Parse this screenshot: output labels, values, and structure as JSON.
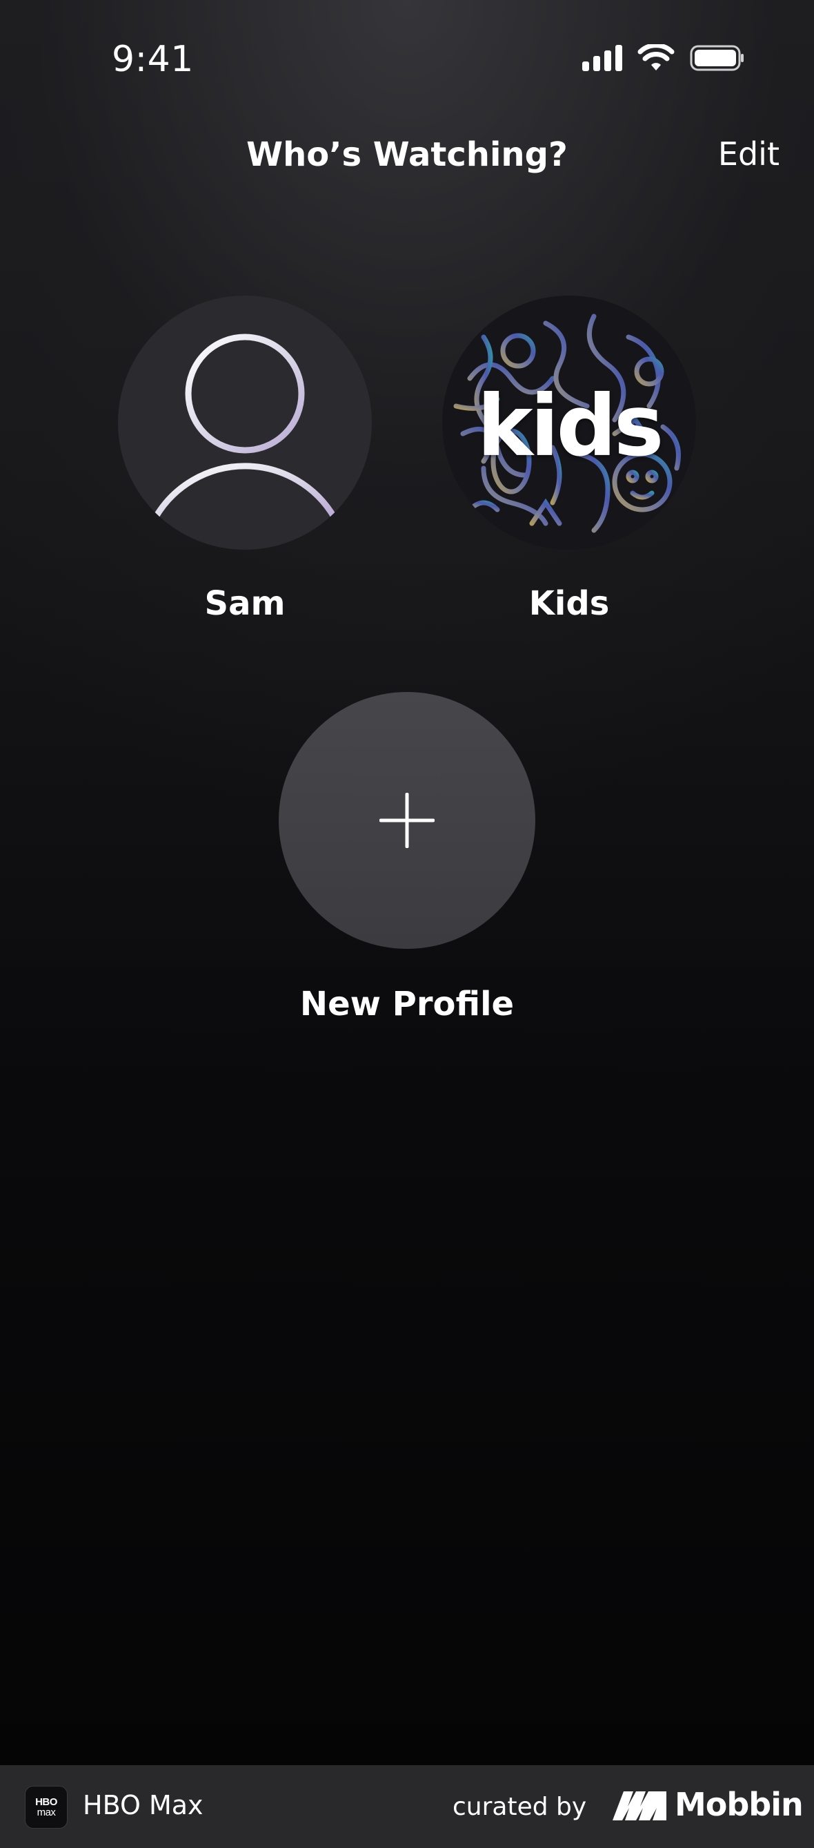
{
  "status_bar": {
    "time": "9:41"
  },
  "header": {
    "title": "Who’s Watching?",
    "edit_label": "Edit"
  },
  "profiles": [
    {
      "name": "Sam",
      "avatar": "user-silhouette-icon"
    },
    {
      "name": "Kids",
      "avatar_text": "kids"
    }
  ],
  "new_profile": {
    "label": "New Profile",
    "icon": "plus-icon"
  },
  "footer": {
    "app_icon_line1": "HBO",
    "app_icon_line2": "max",
    "app_name": "HBO Max",
    "curated_by": "curated by",
    "brand": "Mobbin"
  },
  "colors": {
    "background_top": "#1d1d20",
    "background_bottom": "#050506",
    "new_profile_circle": "#424246",
    "footer": "#29292b"
  }
}
